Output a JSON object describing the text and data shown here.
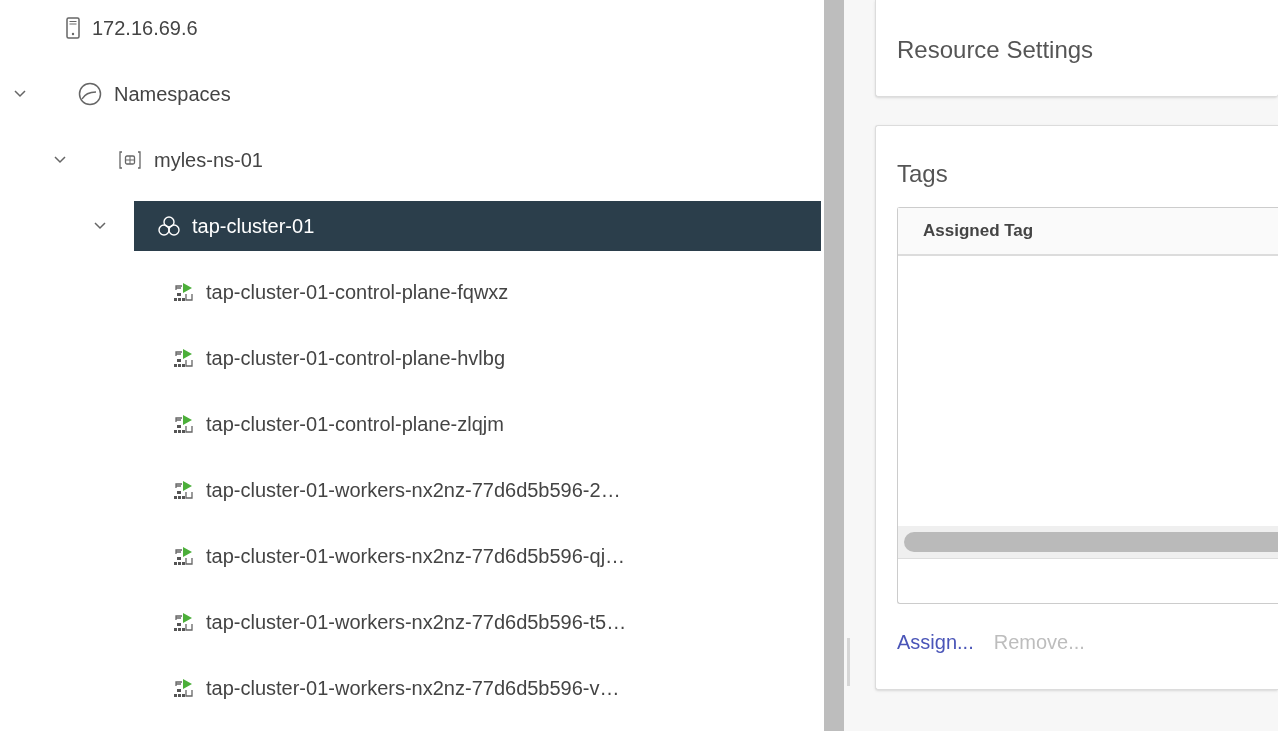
{
  "tree": [
    {
      "kind": "host",
      "label": "172.16.69.6",
      "selected": false
    },
    {
      "kind": "namespaces",
      "label": "Namespaces",
      "selected": false,
      "expanded": true,
      "children": [
        {
          "kind": "namespace",
          "label": "myles-ns-01",
          "selected": false,
          "expanded": true,
          "children": [
            {
              "kind": "cluster",
              "label": "tap-cluster-01",
              "selected": true,
              "expanded": true,
              "children": [
                {
                  "kind": "vm",
                  "label": "tap-cluster-01-control-plane-fqwxz",
                  "selected": false
                },
                {
                  "kind": "vm",
                  "label": "tap-cluster-01-control-plane-hvlbg",
                  "selected": false
                },
                {
                  "kind": "vm",
                  "label": "tap-cluster-01-control-plane-zlqjm",
                  "selected": false
                },
                {
                  "kind": "vm",
                  "label": "tap-cluster-01-workers-nx2nz-77d6d5b596-2…",
                  "selected": false
                },
                {
                  "kind": "vm",
                  "label": "tap-cluster-01-workers-nx2nz-77d6d5b596-qj…",
                  "selected": false
                },
                {
                  "kind": "vm",
                  "label": "tap-cluster-01-workers-nx2nz-77d6d5b596-t5…",
                  "selected": false
                },
                {
                  "kind": "vm",
                  "label": "tap-cluster-01-workers-nx2nz-77d6d5b596-v…",
                  "selected": false
                }
              ]
            }
          ]
        }
      ]
    }
  ],
  "resource_settings": {
    "title": "Resource Settings"
  },
  "tags": {
    "title": "Tags",
    "table": {
      "columns": [
        "Assigned Tag"
      ]
    },
    "actions": [
      {
        "label": "Assign...",
        "disabled": false
      },
      {
        "label": "Remove...",
        "disabled": true
      }
    ]
  }
}
